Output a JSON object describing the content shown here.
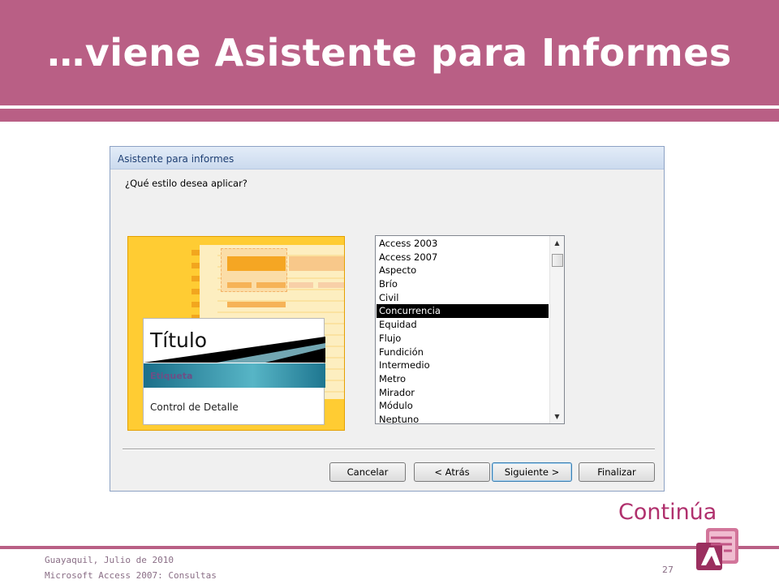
{
  "slide": {
    "title": "…viene Asistente para Informes",
    "continue_label": "Continúa",
    "footer_line1": "Guayaquil, Julio de 2010",
    "footer_line2": "Microsoft Access 2007: Consultas",
    "page_number": "27"
  },
  "dialog": {
    "title": "Asistente para informes",
    "question": "¿Qué estilo desea aplicar?",
    "preview": {
      "title": "Título",
      "label": "Etiqueta",
      "detail": "Control de Detalle"
    },
    "styles": [
      {
        "label": "Access 2003",
        "selected": false
      },
      {
        "label": "Access 2007",
        "selected": false
      },
      {
        "label": "Aspecto",
        "selected": false
      },
      {
        "label": "Brío",
        "selected": false
      },
      {
        "label": "Civil",
        "selected": false
      },
      {
        "label": "Concurrencia",
        "selected": true
      },
      {
        "label": "Equidad",
        "selected": false
      },
      {
        "label": "Flujo",
        "selected": false
      },
      {
        "label": "Fundición",
        "selected": false
      },
      {
        "label": "Intermedio",
        "selected": false
      },
      {
        "label": "Metro",
        "selected": false
      },
      {
        "label": "Mirador",
        "selected": false
      },
      {
        "label": "Módulo",
        "selected": false
      },
      {
        "label": "Neptuno",
        "selected": false
      }
    ],
    "buttons": {
      "cancel": "Cancelar",
      "back": "< Atrás",
      "next": "Siguiente >",
      "finish": "Finalizar"
    }
  },
  "colors": {
    "accent": "#b95f85",
    "continue_text": "#b0306d",
    "selection": "#000000"
  },
  "icons": {
    "logo": "access-logo-icon",
    "scroll_up": "scroll-up-icon",
    "scroll_down": "scroll-down-icon"
  }
}
